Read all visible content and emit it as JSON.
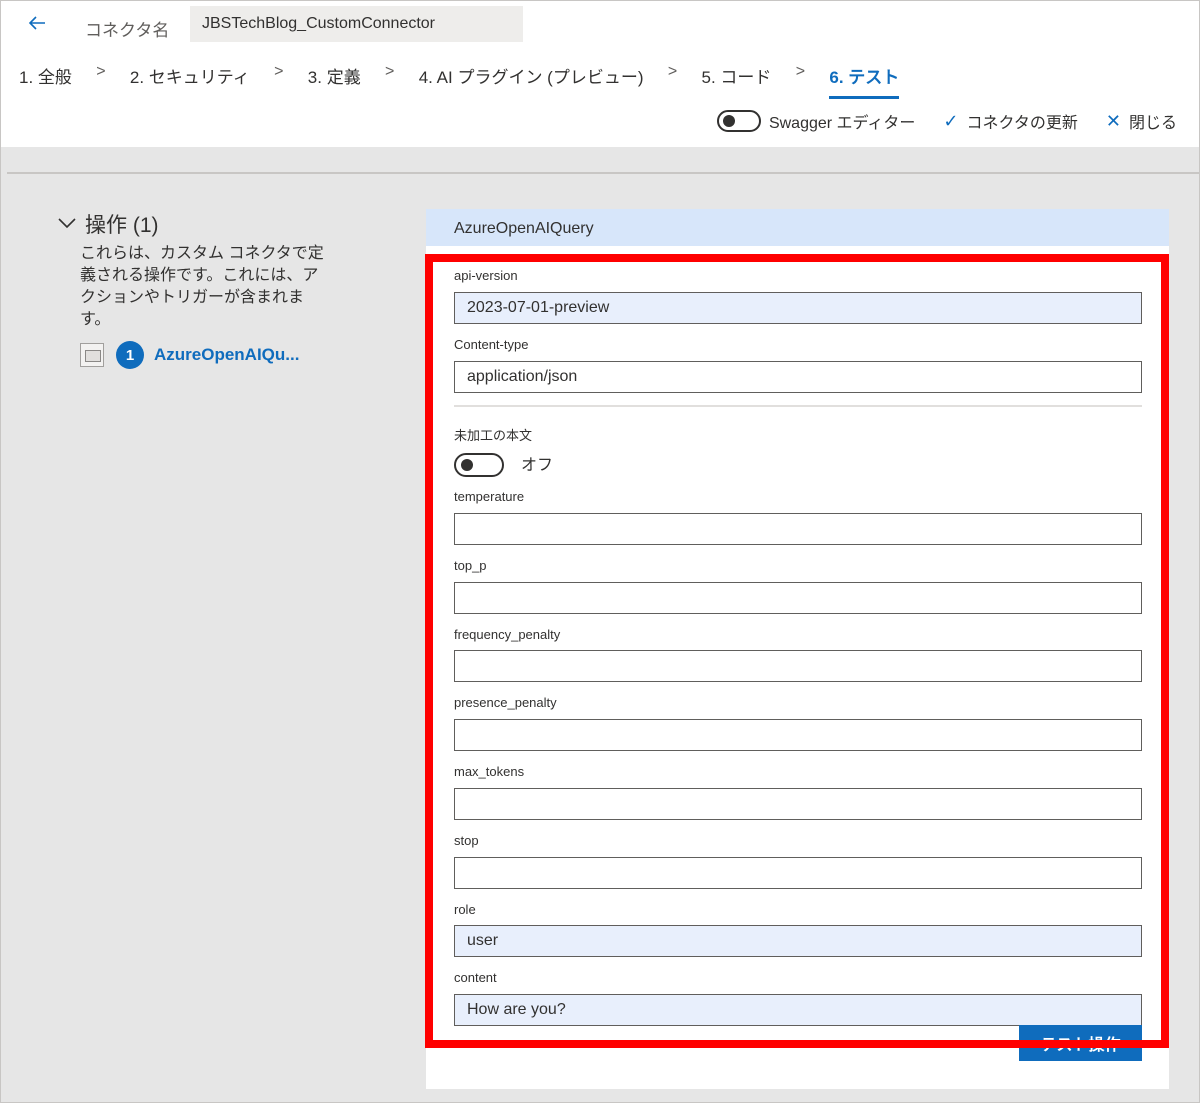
{
  "header": {
    "connector_name_label": "コネクタ名",
    "connector_name_value": "JBSTechBlog_CustomConnector"
  },
  "steps": [
    {
      "label": "1. 全般"
    },
    {
      "label": "2. セキュリティ"
    },
    {
      "label": "3. 定義"
    },
    {
      "label": "4. AI プラグイン (プレビュー)"
    },
    {
      "label": "5. コード"
    },
    {
      "label": "6. テスト"
    }
  ],
  "actions": {
    "swagger_label": "Swagger エディター",
    "update_label": "コネクタの更新",
    "close_label": "閉じる"
  },
  "operations": {
    "title": "操作 (1)",
    "description": "これらは、カスタム コネクタで定義される操作です。これには、アクションやトリガーが含まれます。",
    "item_number": "1",
    "item_name": "AzureOpenAIQu..."
  },
  "panel": {
    "title": "AzureOpenAIQuery",
    "fields": {
      "api_version": {
        "label": "api-version",
        "value": "2023-07-01-preview"
      },
      "content_type": {
        "label": "Content-type",
        "value": "application/json"
      },
      "raw_body": {
        "label": "未加工の本文",
        "toggle_text": "オフ"
      },
      "temperature": {
        "label": "temperature",
        "value": ""
      },
      "top_p": {
        "label": "top_p",
        "value": ""
      },
      "frequency_penalty": {
        "label": "frequency_penalty",
        "value": ""
      },
      "presence_penalty": {
        "label": "presence_penalty",
        "value": ""
      },
      "max_tokens": {
        "label": "max_tokens",
        "value": ""
      },
      "stop": {
        "label": "stop",
        "value": ""
      },
      "role": {
        "label": "role",
        "value": "user"
      },
      "content": {
        "label": "content",
        "value": "How are you?"
      }
    },
    "test_button_label": "テスト操作"
  },
  "colors": {
    "accent": "#0f6cbd",
    "highlight_border": "#ff0000",
    "panel_header_bg": "#d7e6fa",
    "filled_input_bg": "#e8effc"
  }
}
